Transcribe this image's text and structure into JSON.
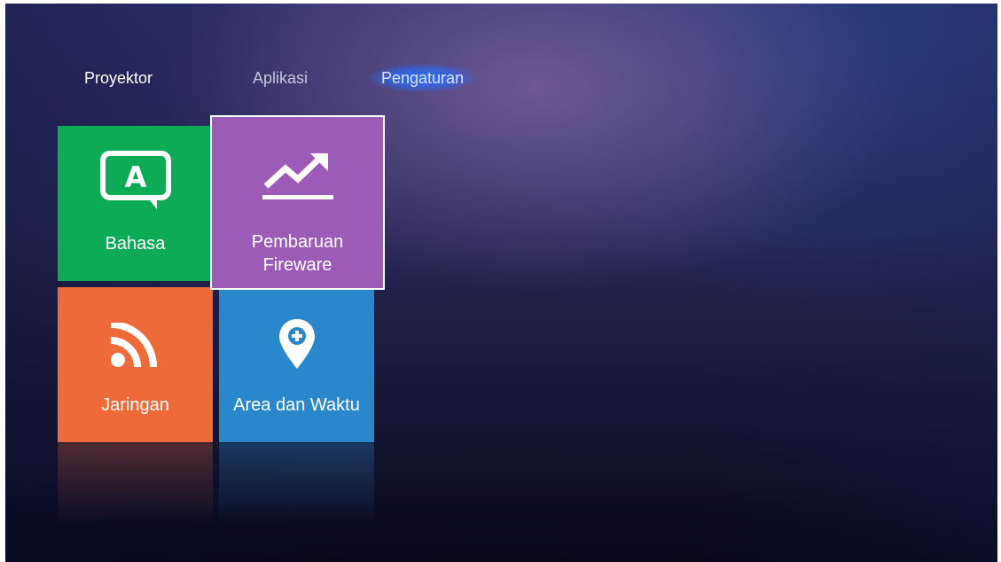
{
  "nav": {
    "tabs": [
      {
        "label": "Proyektor",
        "selected": false
      },
      {
        "label": "Aplikasi",
        "selected": false
      },
      {
        "label": "Pengaturan",
        "selected": true
      }
    ]
  },
  "tiles": [
    {
      "label": "Bahasa",
      "icon": "language-bubble-icon",
      "color": "#0dab55"
    },
    {
      "label_line1": "Pembaruan",
      "label_line2": "Fireware",
      "icon": "trend-up-icon",
      "color": "#9b5bb7",
      "focused": true
    },
    {
      "label": "Jaringan",
      "icon": "wifi-feed-icon",
      "color": "#ee6a38"
    },
    {
      "label": "Area dan Waktu",
      "icon": "location-pin-icon",
      "color": "#2a87cb"
    }
  ],
  "icons": {
    "bahasa_letter": "A"
  },
  "colors": {
    "accent_glow": "#286eff",
    "background_top": "#2e2f6a",
    "background_bottom": "#07081a"
  }
}
